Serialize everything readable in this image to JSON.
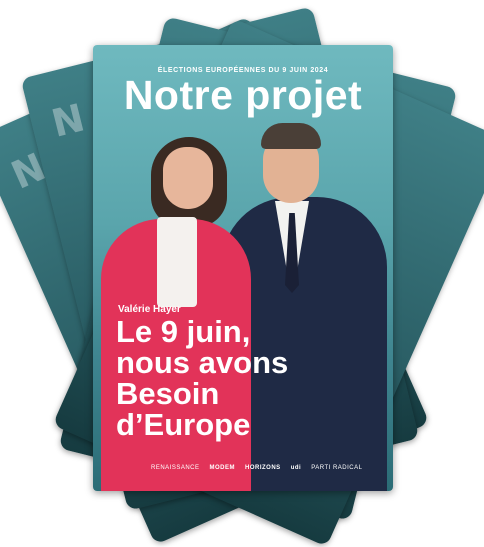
{
  "poster": {
    "election_line": "ÉLECTIONS EUROPÉENNES DU 9 JUIN 2024",
    "title": "Notre projet",
    "candidate_name": "Valérie Hayer",
    "slogan_lines": [
      "Le 9 juin,",
      "nous avons",
      "Besoin",
      "d’Europe"
    ],
    "logos": [
      "RENAISSANCE",
      "MODEM",
      "HORIZONS",
      "udi",
      "PARTI RADICAL"
    ]
  },
  "colors": {
    "poster_teal": "#5aa5ac",
    "jacket_pink": "#e23359",
    "back_card": "#2b5f66"
  }
}
